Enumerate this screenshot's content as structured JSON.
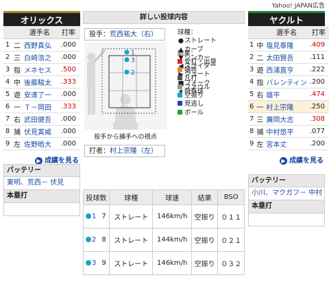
{
  "ad_label": "Yahoo! JAPAN広告",
  "left_team": {
    "name": "オリックス",
    "columns": [
      "",
      "",
      "選手名",
      "打率"
    ],
    "players": [
      {
        "no": "1",
        "pos": "二",
        "name": "西野真弘",
        "avg": ".000",
        "avg_red": false
      },
      {
        "no": "2",
        "pos": "三",
        "name": "白崎浩之",
        "avg": ".000",
        "avg_red": false
      },
      {
        "no": "3",
        "pos": "指",
        "name": "メネセス",
        "avg": ".500",
        "avg_red": true
      },
      {
        "no": "4",
        "pos": "中",
        "name": "後藤駿太",
        "avg": ".333",
        "avg_red": true
      },
      {
        "no": "5",
        "pos": "遊",
        "name": "安達了一",
        "avg": ".000",
        "avg_red": false
      },
      {
        "no": "6",
        "pos": "一",
        "name": "Ｔ－岡田",
        "avg": ".333",
        "avg_red": true
      },
      {
        "no": "7",
        "pos": "右",
        "name": "武田健吾",
        "avg": ".000",
        "avg_red": false
      },
      {
        "no": "8",
        "pos": "捕",
        "name": "伏見寅威",
        "avg": ".000",
        "avg_red": false
      },
      {
        "no": "9",
        "pos": "左",
        "name": "佐野皓大",
        "avg": ".000",
        "avg_red": false
      }
    ],
    "more_label": "成績を見る",
    "battery_title": "バッテリー",
    "battery": "東明、荒西－ 伏見",
    "homerun_title": "本塁打"
  },
  "right_team": {
    "name": "ヤクルト",
    "columns": [
      "",
      "",
      "選手名",
      "打率"
    ],
    "players": [
      {
        "no": "1",
        "pos": "中",
        "name": "塩見泰隆",
        "avg": ".409",
        "avg_red": true,
        "highlight": false
      },
      {
        "no": "2",
        "pos": "二",
        "name": "太田賢吾",
        "avg": ".111",
        "avg_red": false,
        "highlight": false
      },
      {
        "no": "3",
        "pos": "遊",
        "name": "西浦直亨",
        "avg": ".222",
        "avg_red": false,
        "highlight": false
      },
      {
        "no": "4",
        "pos": "指",
        "name": "バレンティン",
        "avg": ".200",
        "avg_red": false,
        "highlight": false
      },
      {
        "no": "5",
        "pos": "右",
        "name": "雄平",
        "avg": ".474",
        "avg_red": true,
        "highlight": false
      },
      {
        "no": "6",
        "pos": "一",
        "name": "村上宗隆",
        "avg": ".250",
        "avg_red": false,
        "highlight": true
      },
      {
        "no": "7",
        "pos": "三",
        "name": "廣岡大志",
        "avg": ".308",
        "avg_red": true,
        "highlight": false
      },
      {
        "no": "8",
        "pos": "捕",
        "name": "中村悠平",
        "avg": ".077",
        "avg_red": false,
        "highlight": false
      },
      {
        "no": "9",
        "pos": "左",
        "name": "宮本丈",
        "avg": ".200",
        "avg_red": false,
        "highlight": false
      }
    ],
    "more_label": "成績を見る",
    "battery_title": "バッテリー",
    "battery": "小川、マクガフ－ 中村",
    "homerun_title": "本塁打"
  },
  "detail": {
    "title": "詳しい投球内容",
    "pitcher_label": "投手：",
    "pitcher": "荒西祐大（右）",
    "batter_label": "打者：",
    "batter": "村上宗隆（左）",
    "view_caption": "投手から捕手への視点",
    "markers": [
      "1",
      "3",
      "2"
    ],
    "pitch_types_title": "球種：",
    "pitch_types": [
      {
        "icon": "●",
        "label": "ストレート"
      },
      {
        "icon": "▲",
        "label": "カーブ"
      },
      {
        "icon": "▼",
        "label": "シンカー"
      },
      {
        "icon": "◀",
        "label": "スライダー"
      },
      {
        "icon": "▶",
        "label": "シュート"
      },
      {
        "icon": "■",
        "label": "フォーク"
      },
      {
        "icon": "★",
        "label": "特殊球"
      }
    ],
    "results_title": "結果：",
    "results": [
      {
        "color": "#d42a2a",
        "label": "安打・出塁"
      },
      {
        "color": "#e58a2a",
        "label": "犠牲"
      },
      {
        "color": "#555555",
        "label": "凡打"
      },
      {
        "color": "#999999",
        "label": "ファウル"
      },
      {
        "color": "#1aa4c4",
        "label": "空振り"
      },
      {
        "color": "#2244aa",
        "label": "見逃し"
      },
      {
        "color": "#22a03a",
        "label": "ボール"
      }
    ]
  },
  "pitch_table": {
    "columns": [
      "投球数",
      "球種",
      "球速",
      "結果",
      "BSO"
    ],
    "rows": [
      {
        "num": "1",
        "seq": "7",
        "type": "ストレート",
        "speed": "146km/h",
        "result": "空振り",
        "bso": "０１１"
      },
      {
        "num": "2",
        "seq": "8",
        "type": "ストレート",
        "speed": "144km/h",
        "result": "空振り",
        "bso": "０２１"
      },
      {
        "num": "3",
        "seq": "9",
        "type": "ストレート",
        "speed": "146km/h",
        "result": "空振り",
        "bso": "０３２"
      }
    ]
  }
}
